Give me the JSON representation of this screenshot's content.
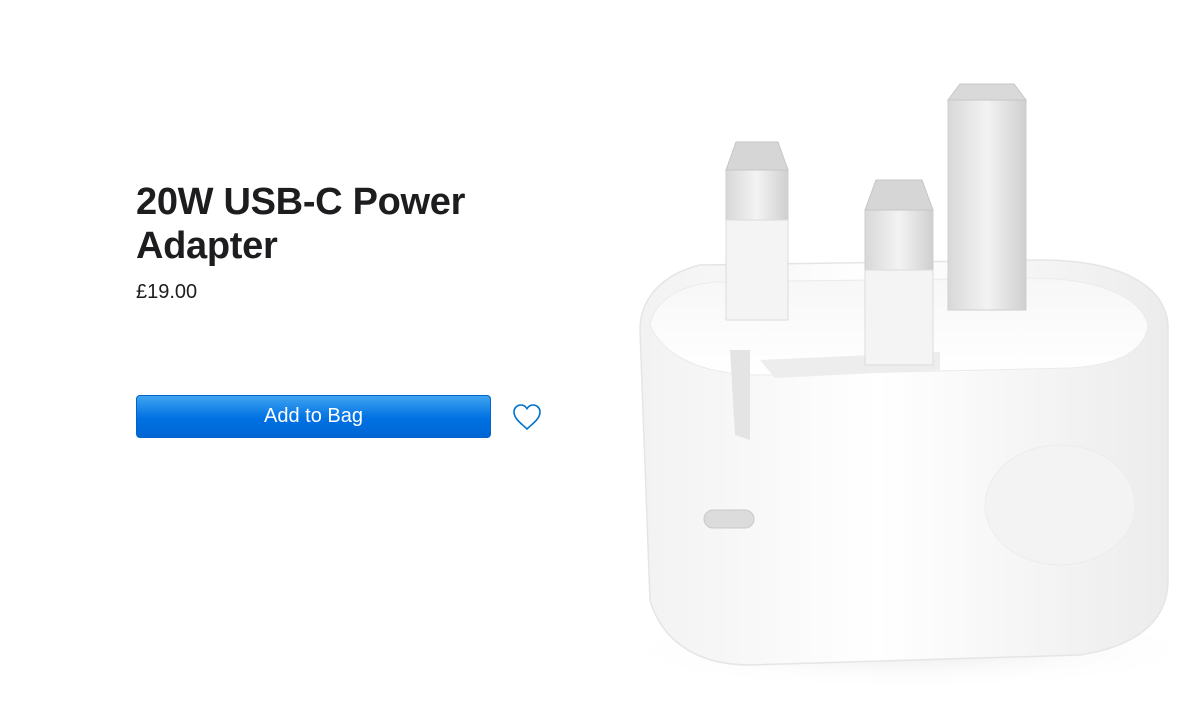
{
  "product": {
    "title_line1": "20W USB-C Power",
    "title_line2": "Adapter",
    "price": "£19.00"
  },
  "actions": {
    "add_to_bag_label": "Add to Bag",
    "favorite_icon": "heart-outline-icon"
  },
  "image": {
    "subject": "power-adapter-image",
    "colors": {
      "body": "#ffffff",
      "pins": "#e6e6e6",
      "accent": "#0071e3"
    }
  }
}
